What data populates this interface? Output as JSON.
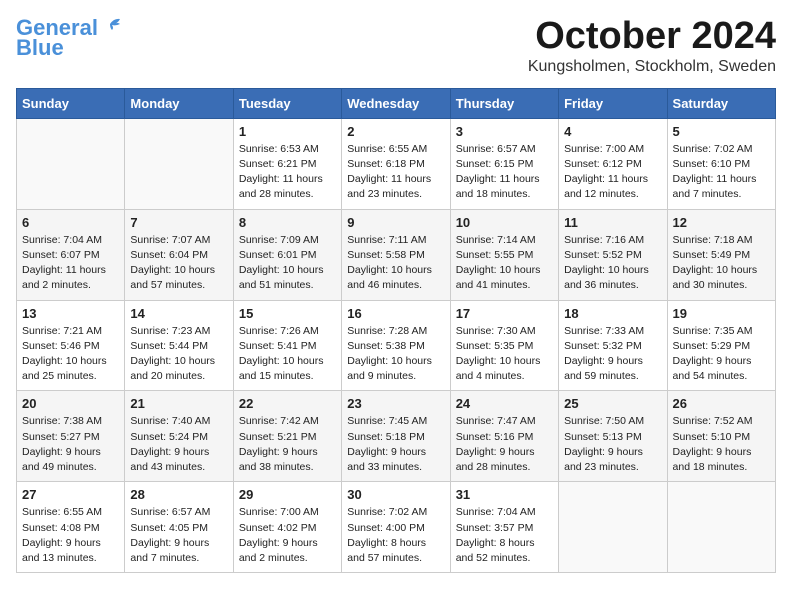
{
  "logo": {
    "line1": "General",
    "line2": "Blue"
  },
  "title": "October 2024",
  "subtitle": "Kungsholmen, Stockholm, Sweden",
  "days_header": [
    "Sunday",
    "Monday",
    "Tuesday",
    "Wednesday",
    "Thursday",
    "Friday",
    "Saturday"
  ],
  "weeks": [
    [
      {
        "day": "",
        "info": ""
      },
      {
        "day": "",
        "info": ""
      },
      {
        "day": "1",
        "info": "Sunrise: 6:53 AM\nSunset: 6:21 PM\nDaylight: 11 hours\nand 28 minutes."
      },
      {
        "day": "2",
        "info": "Sunrise: 6:55 AM\nSunset: 6:18 PM\nDaylight: 11 hours\nand 23 minutes."
      },
      {
        "day": "3",
        "info": "Sunrise: 6:57 AM\nSunset: 6:15 PM\nDaylight: 11 hours\nand 18 minutes."
      },
      {
        "day": "4",
        "info": "Sunrise: 7:00 AM\nSunset: 6:12 PM\nDaylight: 11 hours\nand 12 minutes."
      },
      {
        "day": "5",
        "info": "Sunrise: 7:02 AM\nSunset: 6:10 PM\nDaylight: 11 hours\nand 7 minutes."
      }
    ],
    [
      {
        "day": "6",
        "info": "Sunrise: 7:04 AM\nSunset: 6:07 PM\nDaylight: 11 hours\nand 2 minutes."
      },
      {
        "day": "7",
        "info": "Sunrise: 7:07 AM\nSunset: 6:04 PM\nDaylight: 10 hours\nand 57 minutes."
      },
      {
        "day": "8",
        "info": "Sunrise: 7:09 AM\nSunset: 6:01 PM\nDaylight: 10 hours\nand 51 minutes."
      },
      {
        "day": "9",
        "info": "Sunrise: 7:11 AM\nSunset: 5:58 PM\nDaylight: 10 hours\nand 46 minutes."
      },
      {
        "day": "10",
        "info": "Sunrise: 7:14 AM\nSunset: 5:55 PM\nDaylight: 10 hours\nand 41 minutes."
      },
      {
        "day": "11",
        "info": "Sunrise: 7:16 AM\nSunset: 5:52 PM\nDaylight: 10 hours\nand 36 minutes."
      },
      {
        "day": "12",
        "info": "Sunrise: 7:18 AM\nSunset: 5:49 PM\nDaylight: 10 hours\nand 30 minutes."
      }
    ],
    [
      {
        "day": "13",
        "info": "Sunrise: 7:21 AM\nSunset: 5:46 PM\nDaylight: 10 hours\nand 25 minutes."
      },
      {
        "day": "14",
        "info": "Sunrise: 7:23 AM\nSunset: 5:44 PM\nDaylight: 10 hours\nand 20 minutes."
      },
      {
        "day": "15",
        "info": "Sunrise: 7:26 AM\nSunset: 5:41 PM\nDaylight: 10 hours\nand 15 minutes."
      },
      {
        "day": "16",
        "info": "Sunrise: 7:28 AM\nSunset: 5:38 PM\nDaylight: 10 hours\nand 9 minutes."
      },
      {
        "day": "17",
        "info": "Sunrise: 7:30 AM\nSunset: 5:35 PM\nDaylight: 10 hours\nand 4 minutes."
      },
      {
        "day": "18",
        "info": "Sunrise: 7:33 AM\nSunset: 5:32 PM\nDaylight: 9 hours\nand 59 minutes."
      },
      {
        "day": "19",
        "info": "Sunrise: 7:35 AM\nSunset: 5:29 PM\nDaylight: 9 hours\nand 54 minutes."
      }
    ],
    [
      {
        "day": "20",
        "info": "Sunrise: 7:38 AM\nSunset: 5:27 PM\nDaylight: 9 hours\nand 49 minutes."
      },
      {
        "day": "21",
        "info": "Sunrise: 7:40 AM\nSunset: 5:24 PM\nDaylight: 9 hours\nand 43 minutes."
      },
      {
        "day": "22",
        "info": "Sunrise: 7:42 AM\nSunset: 5:21 PM\nDaylight: 9 hours\nand 38 minutes."
      },
      {
        "day": "23",
        "info": "Sunrise: 7:45 AM\nSunset: 5:18 PM\nDaylight: 9 hours\nand 33 minutes."
      },
      {
        "day": "24",
        "info": "Sunrise: 7:47 AM\nSunset: 5:16 PM\nDaylight: 9 hours\nand 28 minutes."
      },
      {
        "day": "25",
        "info": "Sunrise: 7:50 AM\nSunset: 5:13 PM\nDaylight: 9 hours\nand 23 minutes."
      },
      {
        "day": "26",
        "info": "Sunrise: 7:52 AM\nSunset: 5:10 PM\nDaylight: 9 hours\nand 18 minutes."
      }
    ],
    [
      {
        "day": "27",
        "info": "Sunrise: 6:55 AM\nSunset: 4:08 PM\nDaylight: 9 hours\nand 13 minutes."
      },
      {
        "day": "28",
        "info": "Sunrise: 6:57 AM\nSunset: 4:05 PM\nDaylight: 9 hours\nand 7 minutes."
      },
      {
        "day": "29",
        "info": "Sunrise: 7:00 AM\nSunset: 4:02 PM\nDaylight: 9 hours\nand 2 minutes."
      },
      {
        "day": "30",
        "info": "Sunrise: 7:02 AM\nSunset: 4:00 PM\nDaylight: 8 hours\nand 57 minutes."
      },
      {
        "day": "31",
        "info": "Sunrise: 7:04 AM\nSunset: 3:57 PM\nDaylight: 8 hours\nand 52 minutes."
      },
      {
        "day": "",
        "info": ""
      },
      {
        "day": "",
        "info": ""
      }
    ]
  ]
}
